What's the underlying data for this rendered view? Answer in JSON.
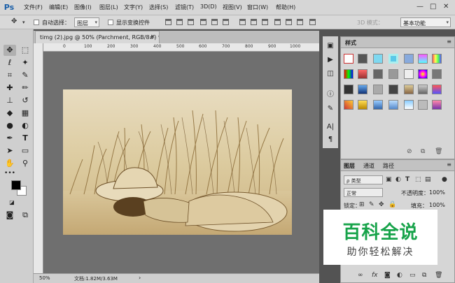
{
  "app": {
    "logo": "Ps"
  },
  "menu": [
    "文件(F)",
    "编辑(E)",
    "图像(I)",
    "图层(L)",
    "文字(Y)",
    "选择(S)",
    "滤镜(T)",
    "3D(D)",
    "视图(V)",
    "窗口(W)",
    "帮助(H)"
  ],
  "window_controls": {
    "minimize": "—",
    "maximize": "□",
    "close": "✕"
  },
  "options": {
    "auto_select_label": "自动选择：",
    "auto_select_value": "图层",
    "show_transform_label": "显示变换控件",
    "mode_3d_label": "3D 模式：",
    "workspace": "基本功能"
  },
  "document": {
    "tab_title": "timg (2).jpg @ 50% (Parchment, RGB/8#) *",
    "close": "×"
  },
  "ruler": {
    "top": [
      "0",
      "100",
      "200",
      "300",
      "400",
      "500",
      "600",
      "700",
      "800",
      "900",
      "1000"
    ]
  },
  "status": {
    "zoom": "50%",
    "doc_size": "文档:1.82M/3.63M",
    "arrow": "›"
  },
  "styles_panel": {
    "title": "样式",
    "menu": "≡"
  },
  "layers_panel": {
    "tabs": [
      "图层",
      "通道",
      "路径"
    ],
    "menu": "≡",
    "filter": "ρ 类型",
    "blend_mode": "正常",
    "opacity_label": "不透明度：",
    "opacity_value": "100%",
    "lock_label": "锁定：",
    "fill_label": "填充：",
    "fill_value": "100%",
    "footer_fx": "fx"
  },
  "watermark": {
    "main": "百科全说",
    "sub": "助你轻松解决"
  },
  "colors": {
    "foreground": "#000000",
    "background": "#ffffff",
    "watermark_green": "#17a34a"
  }
}
